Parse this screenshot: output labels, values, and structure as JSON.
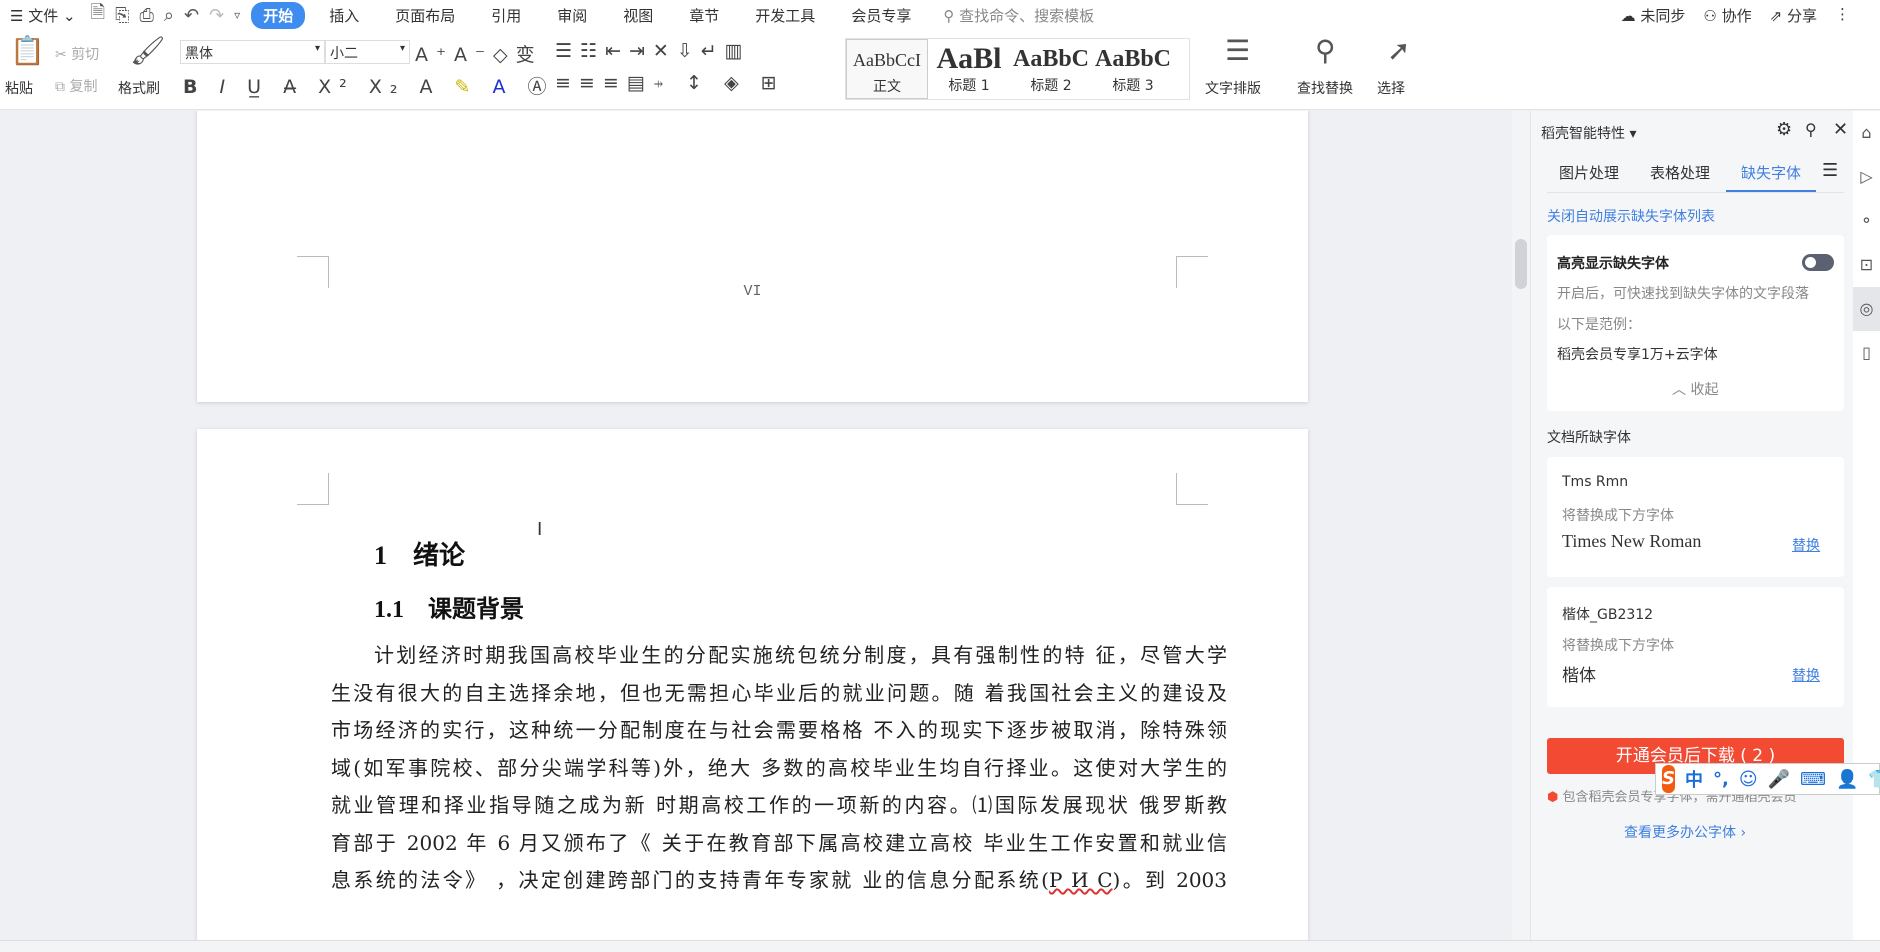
{
  "menubar": {
    "file": "文件",
    "tabs": [
      "开始",
      "插入",
      "页面布局",
      "引用",
      "审阅",
      "视图",
      "章节",
      "开发工具",
      "会员专享"
    ],
    "active_tab": "开始",
    "search_placeholder": "查找命令、搜索模板",
    "sync": "未同步",
    "collab": "协作",
    "share": "分享"
  },
  "ribbon": {
    "paste": "粘贴",
    "cut": "剪切",
    "copy": "复制",
    "format_painter": "格式刷",
    "font": "黑体",
    "size": "小二",
    "styles": [
      {
        "preview": "AaBbCcI",
        "label": "正文"
      },
      {
        "preview": "AaBl",
        "label": "标题 1"
      },
      {
        "preview": "AaBbC",
        "label": "标题 2"
      },
      {
        "preview": "AaBbC",
        "label": "标题 3"
      }
    ],
    "text_layout": "文字排版",
    "find_replace": "查找替换",
    "select": "选择"
  },
  "document": {
    "page_number": "VI",
    "heading1": "1　绪论",
    "heading2": "1.1　课题背景",
    "lines": [
      "计划经济时期我国高校毕业生的分配实施统包统分制度，具有强制性的特 征，尽管大学",
      "生没有很大的自主选择余地，但也无需担心毕业后的就业问题。随 着我国社会主义的建设及",
      "市场经济的实行，这种统一分配制度在与社会需要格格 不入的现实下逐步被取消，除特殊领",
      "域(如军事院校、部分尖端学科等)外，绝大 多数的高校毕业生均自行择业。这使对大学生的",
      "就业管理和择业指导随之成为新 时期高校工作的一项新的内容。⑴国际发展现状 俄罗斯教",
      "育部于 2002 年 6 月又颁布了《 关于在教育部下属高校建立高校 毕业生工作安置和就业信"
    ],
    "last_line_a": "息系统的法令》 ，决定创建跨部门的支持青年专家就 业的信息分配系统(",
    "last_line_err": "Р И С",
    "last_line_b": ")。到 2003"
  },
  "panel": {
    "title": "稻壳智能特性",
    "tabs": [
      "图片处理",
      "表格处理",
      "缺失字体"
    ],
    "active_tab": "缺失字体",
    "close_auto": "关闭自动展示缺失字体列表",
    "highlight_title": "高亮显示缺失字体",
    "highlight_on": false,
    "highlight_desc": "开启后，可快速找到缺失字体的文字段落",
    "example_label": "以下是范例：",
    "example": "稻壳会员专享1万+云字体",
    "collapse": "收起",
    "missing_title": "文档所缺字体",
    "fonts": [
      {
        "name": "Tms Rmn",
        "hint": "将替换成下方字体",
        "replacement": "Times New Roman",
        "action": "替换"
      },
      {
        "name": "楷体_GB2312",
        "hint": "将替换成下方字体",
        "replacement": "楷体",
        "action": "替换"
      }
    ],
    "download_button": "开通会员后下载 ( 2 )",
    "member_note": "包含稻壳会员专享字体，需开通稻壳会员",
    "more_fonts": "查看更多办公字体 ›",
    "accent": "#3f7fe0",
    "button_color": "#f34a34"
  },
  "ime": {
    "mode": "中",
    "punct": "°,"
  }
}
